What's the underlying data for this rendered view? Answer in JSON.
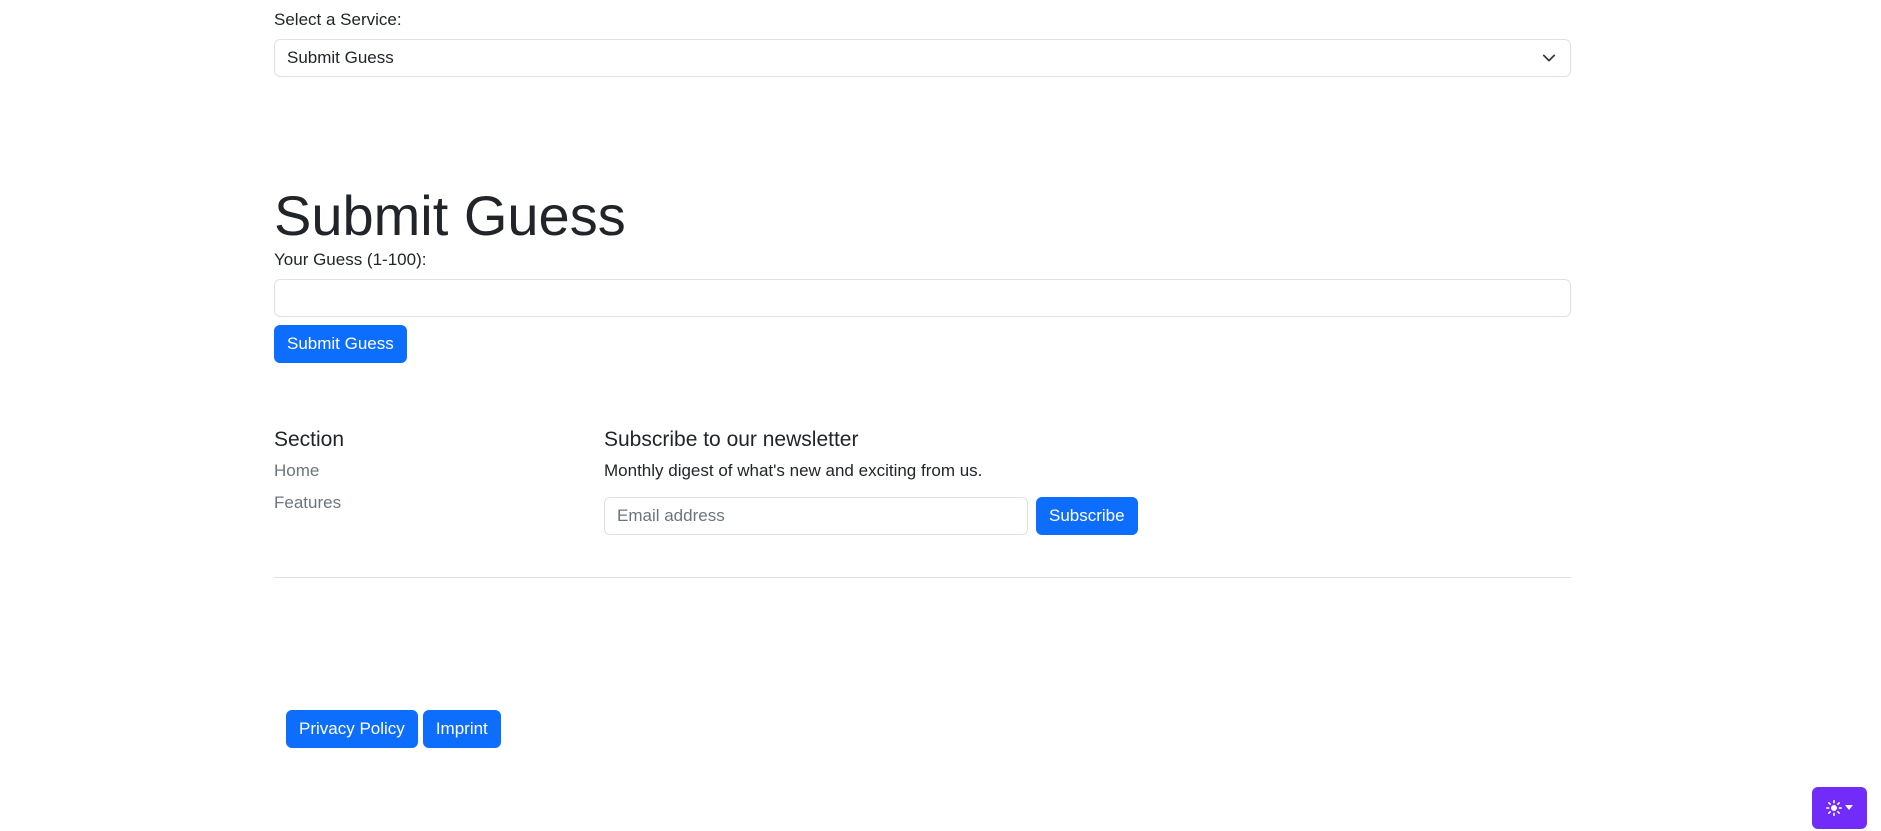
{
  "service_select": {
    "label": "Select a Service:",
    "selected": "Submit Guess"
  },
  "main": {
    "title": "Submit Guess",
    "guess_label": "Your Guess (1-100):",
    "guess_value": "",
    "submit_label": "Submit Guess"
  },
  "footer": {
    "section": {
      "title": "Section",
      "links": [
        "Home",
        "Features"
      ]
    },
    "newsletter": {
      "title": "Subscribe to our newsletter",
      "description": "Monthly digest of what's new and exciting from us.",
      "email_placeholder": "Email address",
      "subscribe_label": "Subscribe"
    },
    "bottom_links": [
      "Privacy Policy",
      "Imprint"
    ]
  },
  "theme_toggle": {
    "icon": "sun-icon",
    "caret": "caret-down-icon",
    "color": "#712cf9"
  },
  "colors": {
    "primary": "#0d6efd",
    "muted": "#6c757d",
    "border": "#dee2e6"
  }
}
